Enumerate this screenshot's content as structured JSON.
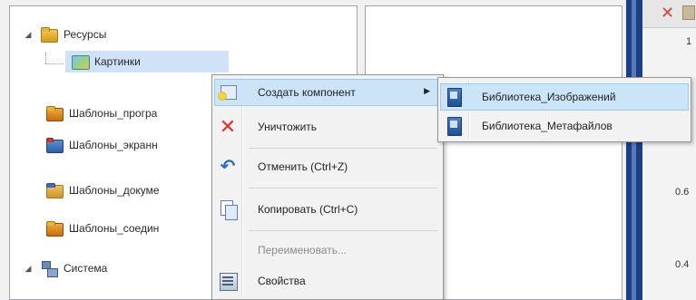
{
  "tree": {
    "items": [
      {
        "label": "Ресурсы",
        "expander": "◢"
      },
      {
        "label": "Картинки"
      },
      {
        "label": "Шаблоны_програ"
      },
      {
        "label": "Шаблоны_экранн"
      },
      {
        "label": "Шаблоны_докуме"
      },
      {
        "label": "Шаблоны_соедин"
      },
      {
        "label": "Система",
        "expander": "◢"
      }
    ]
  },
  "context_menu": {
    "items": [
      {
        "label": "Создать компонент",
        "arrow": "▶",
        "state": "highlighted"
      },
      {
        "label": "Уничтожить"
      },
      {
        "label": "Отменить (Ctrl+Z)"
      },
      {
        "label": "Копировать (Ctrl+C)"
      },
      {
        "label": "Переименовать...",
        "state": "disabled"
      },
      {
        "label": "Свойства"
      }
    ]
  },
  "submenu": {
    "items": [
      {
        "label": "Библиотека_Изображений",
        "state": "highlighted"
      },
      {
        "label": "Библиотека_Метафайлов"
      }
    ]
  },
  "right_panel": {
    "axis_values": [
      "1",
      "0.6",
      "0.4"
    ]
  },
  "colors": {
    "highlight": "#cce4f7",
    "delete_icon": "#e0302a",
    "divider": "#1a3f86"
  }
}
